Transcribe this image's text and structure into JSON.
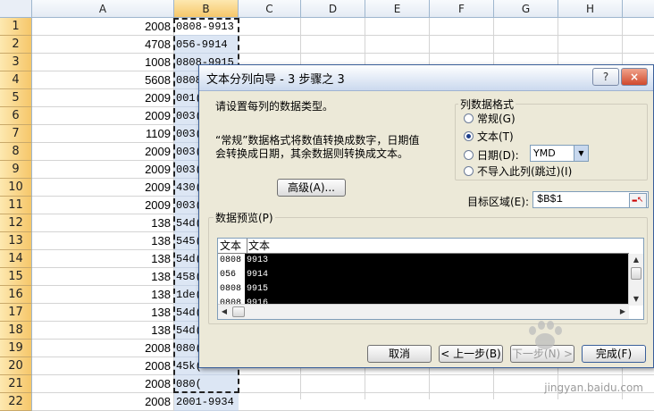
{
  "sheet": {
    "columns": [
      "A",
      "B",
      "C",
      "D",
      "E",
      "F",
      "G",
      "H"
    ],
    "rows": [
      {
        "n": "1",
        "a": "2008",
        "b": "0808-9913"
      },
      {
        "n": "2",
        "a": "4708",
        "b": "056-9914"
      },
      {
        "n": "3",
        "a": "1008",
        "b": "0808-9915"
      },
      {
        "n": "4",
        "a": "5608",
        "b": "0808"
      },
      {
        "n": "5",
        "a": "2009",
        "b": "001("
      },
      {
        "n": "6",
        "a": "2009",
        "b": "003("
      },
      {
        "n": "7",
        "a": "1109",
        "b": "003("
      },
      {
        "n": "8",
        "a": "2009",
        "b": "003("
      },
      {
        "n": "9",
        "a": "2009",
        "b": "003("
      },
      {
        "n": "10",
        "a": "2009",
        "b": "430("
      },
      {
        "n": "11",
        "a": "2009",
        "b": "003("
      },
      {
        "n": "12",
        "a": "138",
        "b": "54d("
      },
      {
        "n": "13",
        "a": "138",
        "b": "545("
      },
      {
        "n": "14",
        "a": "138",
        "b": "54d("
      },
      {
        "n": "15",
        "a": "138",
        "b": "458("
      },
      {
        "n": "16",
        "a": "138",
        "b": "1de("
      },
      {
        "n": "17",
        "a": "138",
        "b": "54d("
      },
      {
        "n": "18",
        "a": "138",
        "b": "54d("
      },
      {
        "n": "19",
        "a": "2008",
        "b": "080("
      },
      {
        "n": "20",
        "a": "2008",
        "b": "45k("
      },
      {
        "n": "21",
        "a": "2008",
        "b": "080("
      },
      {
        "n": "22",
        "a": "2008",
        "b": "2001-9934"
      }
    ]
  },
  "dialog": {
    "title": "文本分列向导 - 3 步骤之 3",
    "help_label": "?",
    "close_label": "×",
    "instruction": "请设置每列的数据类型。",
    "description_line1": "“常规”数据格式将数值转换成数字，日期值",
    "description_line2": "会转换成日期，其余数据则转换成文本。",
    "advanced_label": "高级(A)...",
    "format_group_label": "列数据格式",
    "radio_general": "常规(G)",
    "radio_text": "文本(T)",
    "radio_date": "日期(D):",
    "radio_skip": "不导入此列(跳过)(I)",
    "date_format": "YMD",
    "target_label": "目标区域(E):",
    "target_value": "$B$1",
    "preview_label": "数据预览(P)",
    "preview_headers": [
      "文本",
      "文本"
    ],
    "preview_col1": [
      "0808",
      "056",
      "0808",
      "0808"
    ],
    "preview_col2": [
      "9913",
      "9914",
      "9915",
      "9916"
    ],
    "cancel_label": "取消",
    "back_label": "< 上一步(B)",
    "next_label": "下一步(N) >",
    "finish_label": "完成(F)"
  },
  "watermark": {
    "text": "jingyan.baidu.com"
  },
  "colors": {
    "selection_fill": "#dce6f4",
    "header_highlight": "#f6c76a",
    "dialog_face": "#ece9d8",
    "preview_selected": "#000000"
  }
}
